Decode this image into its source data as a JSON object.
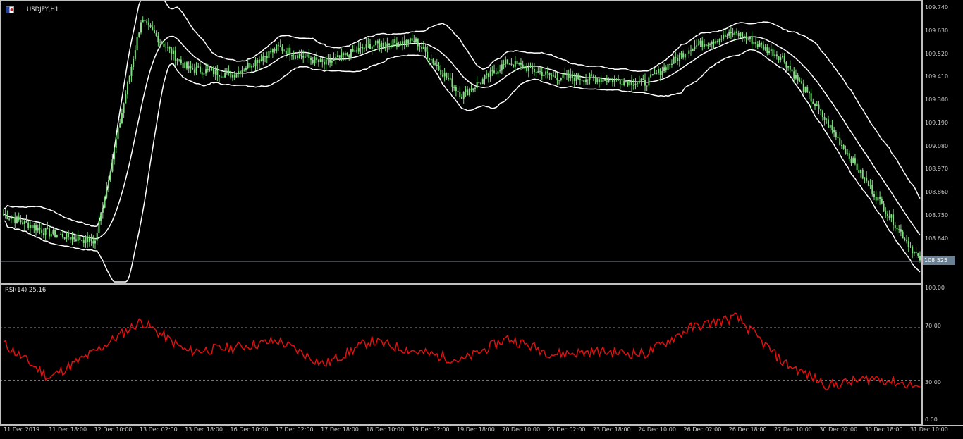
{
  "chart": {
    "symbol": "USDJPY,H1",
    "current_price": "108.525",
    "price_axis": [
      "109.740",
      "109.630",
      "109.520",
      "109.410",
      "109.300",
      "109.190",
      "109.080",
      "108.970",
      "108.860",
      "108.750",
      "108.640",
      "108.525"
    ],
    "rsi_axis": [
      "100.00",
      "70.00",
      "30.00",
      "0.00"
    ],
    "rsi_title": "RSI(14) 25.16",
    "time_axis": [
      "11 Dec 2019",
      "11 Dec 18:00",
      "12 Dec 10:00",
      "13 Dec 02:00",
      "13 Dec 18:00",
      "16 Dec 10:00",
      "17 Dec 02:00",
      "17 Dec 18:00",
      "18 Dec 10:00",
      "19 Dec 02:00",
      "19 Dec 18:00",
      "20 Dec 10:00",
      "23 Dec 02:00",
      "23 Dec 18:00",
      "24 Dec 10:00",
      "26 Dec 02:00",
      "26 Dec 18:00",
      "27 Dec 10:00",
      "30 Dec 02:00",
      "30 Dec 18:00",
      "31 Dec 10:00"
    ],
    "colors": {
      "candle": "#7ee07e",
      "bands": "#ffffff",
      "rsi": "#e01010",
      "grid": "#c0c0c0"
    }
  },
  "chart_data": {
    "type": "line",
    "title": "USDJPY,H1",
    "x": [
      "11 Dec 2019",
      "11 Dec 18:00",
      "12 Dec 10:00",
      "13 Dec 02:00",
      "13 Dec 18:00",
      "16 Dec 10:00",
      "17 Dec 02:00",
      "17 Dec 18:00",
      "18 Dec 10:00",
      "19 Dec 02:00",
      "19 Dec 18:00",
      "20 Dec 10:00",
      "23 Dec 02:00",
      "23 Dec 18:00",
      "24 Dec 10:00",
      "26 Dec 02:00",
      "26 Dec 18:00",
      "27 Dec 10:00",
      "30 Dec 02:00",
      "30 Dec 18:00",
      "31 Dec 10:00"
    ],
    "series": [
      {
        "name": "USDJPY,H1",
        "values": [
          108.75,
          108.66,
          108.62,
          109.68,
          109.45,
          109.42,
          109.55,
          109.47,
          109.56,
          109.58,
          109.32,
          109.48,
          109.41,
          109.4,
          109.38,
          109.55,
          109.62,
          109.5,
          109.18,
          108.85,
          108.53
        ]
      },
      {
        "name": "RSI(14)",
        "values": [
          58,
          32,
          52,
          75,
          52,
          55,
          60,
          42,
          60,
          52,
          45,
          62,
          50,
          52,
          50,
          70,
          78,
          44,
          26,
          32,
          25.16
        ]
      }
    ],
    "ylim": [
      108.525,
      109.74
    ],
    "rsi_levels": [
      30,
      70
    ],
    "rsi_ylim": [
      0,
      100
    ]
  }
}
